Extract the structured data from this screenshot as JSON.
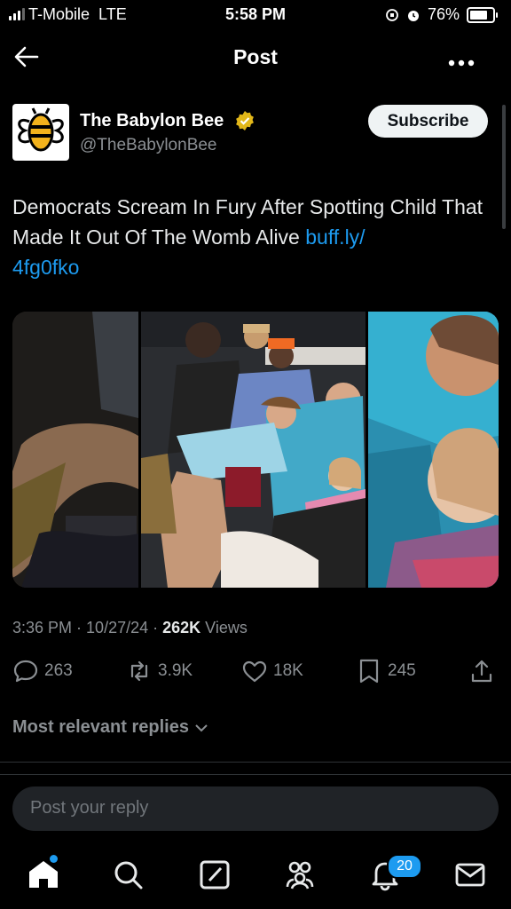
{
  "status_bar": {
    "carrier": "T-Mobile",
    "network": "LTE",
    "time": "5:58 PM",
    "battery": "76%",
    "battery_level": 0.76
  },
  "nav": {
    "title": "Post"
  },
  "post": {
    "author_name": "The Babylon Bee",
    "handle": "@TheBabylonBee",
    "subscribe_label": "Subscribe",
    "text": "Democrats Scream In Fury After Spotting Child That Made It Out Of The Womb Alive ",
    "link": "buff.ly/\n4fg0fko",
    "time": "3:36 PM",
    "date": "10/27/24",
    "views_count": "262K",
    "views_label": "Views",
    "replies": "263",
    "reposts": "3.9K",
    "likes": "18K",
    "bookmarks": "245"
  },
  "replies_section": {
    "sort_label": "Most relevant replies"
  },
  "composer": {
    "placeholder": "Post your reply"
  },
  "tab_bar": {
    "notifications_badge": "20"
  },
  "colors": {
    "accent": "#1d9bf0",
    "verified_gold": "#e2b719",
    "background": "#000000"
  }
}
